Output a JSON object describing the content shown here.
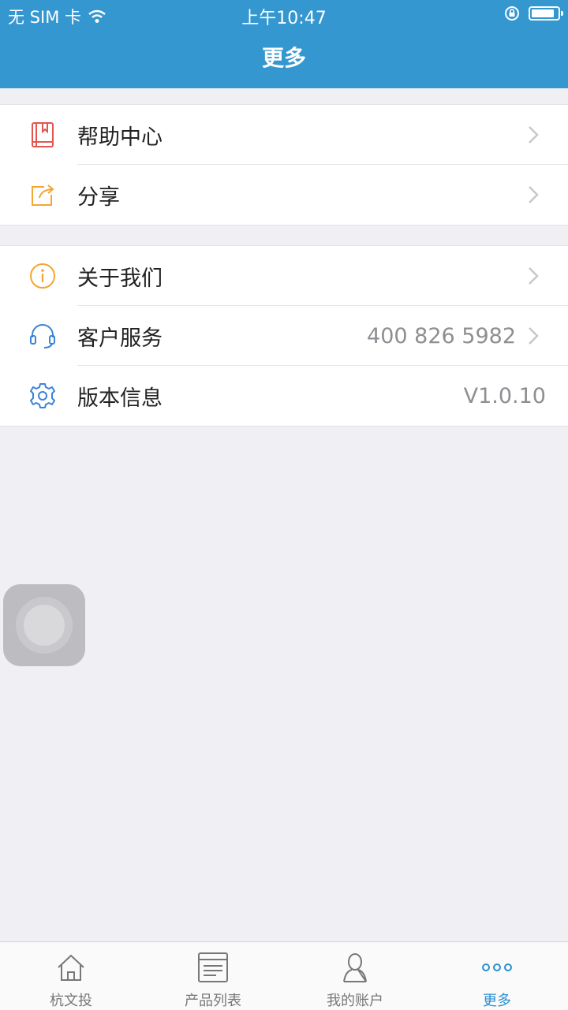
{
  "status_bar": {
    "carrier": "无 SIM 卡",
    "time": "上午10:47"
  },
  "header": {
    "title": "更多"
  },
  "section1": [
    {
      "label": "帮助中心",
      "icon": "book-icon"
    },
    {
      "label": "分享",
      "icon": "share-icon"
    }
  ],
  "section2": [
    {
      "label": "关于我们",
      "icon": "info-icon"
    },
    {
      "label": "客户服务",
      "value": "400 826 5982",
      "icon": "headset-icon"
    },
    {
      "label": "版本信息",
      "value": "V1.0.10",
      "icon": "gear-icon"
    }
  ],
  "tabs": [
    {
      "label": "杭文投",
      "icon": "home-icon"
    },
    {
      "label": "产品列表",
      "icon": "list-icon"
    },
    {
      "label": "我的账户",
      "icon": "user-icon"
    },
    {
      "label": "更多",
      "icon": "more-icon",
      "active": true
    }
  ],
  "colors": {
    "header": "#3597d0",
    "active_tab": "#2b8fcf",
    "background": "#efeff4"
  }
}
